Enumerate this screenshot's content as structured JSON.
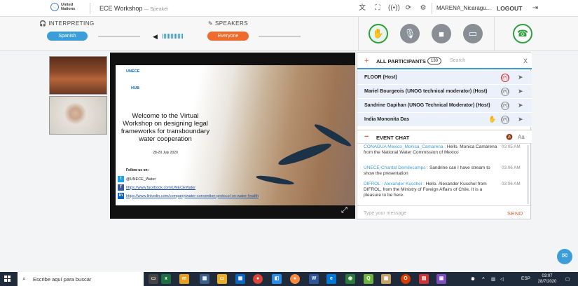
{
  "topbar": {
    "org_line1": "United",
    "org_line2": "Nations",
    "title": "ECE Workshop",
    "role": " — Speaker",
    "user": "MARENA_Nicaragu...",
    "logout": "LOGOUT"
  },
  "controls": {
    "interpreting_label": "INTERPRETING",
    "language": "Spanish",
    "speakers_label": "SPEAKERS",
    "speakers_value": "Everyone"
  },
  "slide": {
    "unece": "UNECE",
    "hub": "HUB",
    "title_lines": [
      "Welcome to the Virtual",
      "Workshop on designing legal",
      "frameworks for transboundary",
      "water cooperation"
    ],
    "date": "28-29 July 2020",
    "follow": "Follow us on:",
    "twitter": "@UNECE_Water",
    "facebook": "https://www.facebook.com/UNECEWater",
    "linkedin": "https://www.linkedin.com/company/water-convention-protocol-on-water-health"
  },
  "participants": {
    "header": "ALL PARTICIPANTS",
    "count": "130",
    "search_placeholder": "Search",
    "rows": [
      {
        "name": "FLOOR (Host)"
      },
      {
        "name": "Mariel Bourgeois (UNOG technical moderator) (Host)"
      },
      {
        "name": "Sandrine Gapihan (UNOG Technical Moderator) (Host)"
      },
      {
        "name": "India Mononita Das"
      }
    ]
  },
  "chat": {
    "header": "EVENT CHAT",
    "messages": [
      {
        "from": "CONAGUA Mexico_Monica_Camarena :",
        "text": "Hello. Monica Camarena from the National Water Commission of Mexico",
        "time": "03:05 AM"
      },
      {
        "from": "UNECE-Chantal Demilecamps :",
        "text": "Sandrine can I have stream to show the presentation",
        "time": "03:06 AM"
      },
      {
        "from": "DIFROL - Alexander Kuschel :",
        "text": "Hello. Alexander Kuschel from DIFROL, from the Ministry of Foreign Affairs of Chile. It is a pleasure to be here.",
        "time": "03:06 AM"
      }
    ],
    "input_placeholder": "Type your message",
    "send": "SEND"
  },
  "taskbar": {
    "search": "Escribe aquí para buscar",
    "lang": "ESP",
    "time": "03:07",
    "date": "28/7/2020"
  },
  "colors": {
    "accent_blue": "#3b9ed8",
    "accent_orange": "#f06a2d",
    "green": "#2e9e3e"
  }
}
